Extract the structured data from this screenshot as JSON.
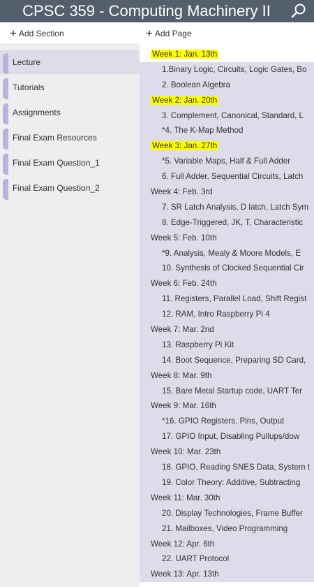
{
  "title": "CPSC 359 - Computing Machinery II",
  "toolbar": {
    "add_section": "Add Section",
    "add_page": "Add Page",
    "plus": "+"
  },
  "sections": [
    {
      "label": "Lecture"
    },
    {
      "label": "Tutorials"
    },
    {
      "label": "Assignments"
    },
    {
      "label": "Final Exam Resources"
    },
    {
      "label": "Final Exam Question_1"
    },
    {
      "label": "Final Exam Question_2"
    }
  ],
  "pages": [
    {
      "label": "Week 1: Jan. 13th",
      "level": 0,
      "highlight": true,
      "selected": true
    },
    {
      "label": "1.Binary Logic, Circuits, Logic Gates, Bo",
      "level": 1
    },
    {
      "label": "2. Boolean Algebra",
      "level": 1
    },
    {
      "label": "Week 2: Jan. 20th",
      "level": 0,
      "highlight": true
    },
    {
      "label": "3. Complement, Canonical, Standard, L",
      "level": 1
    },
    {
      "label": "*4. The K-Map Method",
      "level": 1
    },
    {
      "label": "Week 3: Jan. 27th",
      "level": 0,
      "highlight": true
    },
    {
      "label": "*5. Variable Maps, Half & Full Adder",
      "level": 1
    },
    {
      "label": "6. Full Adder, Sequential Circuits, Latch",
      "level": 1
    },
    {
      "label": "Week 4: Feb. 3rd",
      "level": 0
    },
    {
      "label": "7. SR Latch Analysis, D latch, Latch Sym",
      "level": 1
    },
    {
      "label": "8. Edge-Triggered, JK, T, Characteristic",
      "level": 1
    },
    {
      "label": "Week 5: Feb. 10th",
      "level": 0
    },
    {
      "label": "*9. Analysis, Mealy & Moore Models, E",
      "level": 1
    },
    {
      "label": "10. Synthesis of Clocked Sequential Cir",
      "level": 1
    },
    {
      "label": "Week 6: Feb. 24th",
      "level": 0
    },
    {
      "label": "11. Registers, Parallel Load, Shift Regist",
      "level": 1
    },
    {
      "label": "12. RAM, Intro Raspberry Pi 4",
      "level": 1
    },
    {
      "label": "Week 7: Mar. 2nd",
      "level": 0
    },
    {
      "label": "13. Raspberry Pi Kit",
      "level": 1
    },
    {
      "label": "14. Boot Sequence, Preparing SD Card,",
      "level": 1
    },
    {
      "label": "Week 8: Mar. 9th",
      "level": 0
    },
    {
      "label": "15. Bare Metal Startup code, UART Ter",
      "level": 1
    },
    {
      "label": "Week 9: Mar. 16th",
      "level": 0
    },
    {
      "label": "*16. GPIO Registers, Pins, Output",
      "level": 1
    },
    {
      "label": "17. GPIO Input, Disabling Pullups/dow",
      "level": 1
    },
    {
      "label": "Week 10: Mar. 23th",
      "level": 0
    },
    {
      "label": "18. GPIO, Reading SNES Data, System t",
      "level": 1
    },
    {
      "label": "19. Color Theory: Additive, Subtracting",
      "level": 1
    },
    {
      "label": "Week 11: Mar. 30th",
      "level": 0
    },
    {
      "label": "20. Display Technologies, Frame Buffer",
      "level": 1
    },
    {
      "label": "21. Mailboxes, Video Programming",
      "level": 1
    },
    {
      "label": "Week 12: Apr. 6th",
      "level": 0
    },
    {
      "label": "22. UART Protocol",
      "level": 1
    },
    {
      "label": "Week 13: Apr. 13th",
      "level": 0
    }
  ]
}
